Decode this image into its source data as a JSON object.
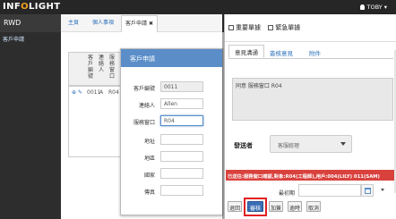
{
  "app": {
    "logo_pre": "INF",
    "logo_o": "O",
    "logo_post": "LIGHT",
    "name": "RWD",
    "user": "TOBY",
    "user_caret": "▾"
  },
  "sidebar": {
    "items": [
      {
        "label": "客戶申請"
      }
    ]
  },
  "tabs": [
    {
      "label": "主頁"
    },
    {
      "label": "個人事項"
    },
    {
      "label": "客戶申請",
      "close": "✖"
    }
  ],
  "grid": {
    "headers": [
      "客戶編號",
      "連絡人",
      "服務窗口"
    ],
    "row": {
      "cells": [
        "0011",
        "A",
        "R04"
      ],
      "ctrl_icons": "⊕ ✎"
    }
  },
  "form": {
    "title": "客戶申請",
    "fields": [
      {
        "label": "客戶編號",
        "value": "0011"
      },
      {
        "label": "連絡人",
        "value": "Allen"
      },
      {
        "label": "服務窗口",
        "value": "R04"
      },
      {
        "label": "地址",
        "value": ""
      },
      {
        "label": "地區",
        "value": ""
      },
      {
        "label": "國家",
        "value": ""
      },
      {
        "label": "傳真",
        "value": ""
      }
    ]
  },
  "flow": {
    "checks": [
      {
        "label": "重要單據"
      },
      {
        "label": "緊急單據"
      }
    ],
    "tabs": [
      {
        "label": "意見溝通"
      },
      {
        "label": "簽核意見"
      },
      {
        "label": "附件"
      }
    ],
    "comment": "同意 服務窗口 R04",
    "sender_label": "發送者",
    "sender_value": "客服經理",
    "status": "已送往:服務窗口確認,對象:R04(工程師),用戶:004(LILY) 011(SAM)",
    "reply_date_label": "最初期"
  },
  "buttons": [
    {
      "label": "退回"
    },
    {
      "label": "審核"
    },
    {
      "label": "加簽"
    },
    {
      "label": "逾時"
    },
    {
      "label": "取消"
    }
  ],
  "colors": {
    "topbar": "#262626",
    "header_blue": "#5b8ec9",
    "primary_button": "#3a6fb5",
    "status_red": "#d9413d",
    "highlight_red": "#e02020"
  }
}
